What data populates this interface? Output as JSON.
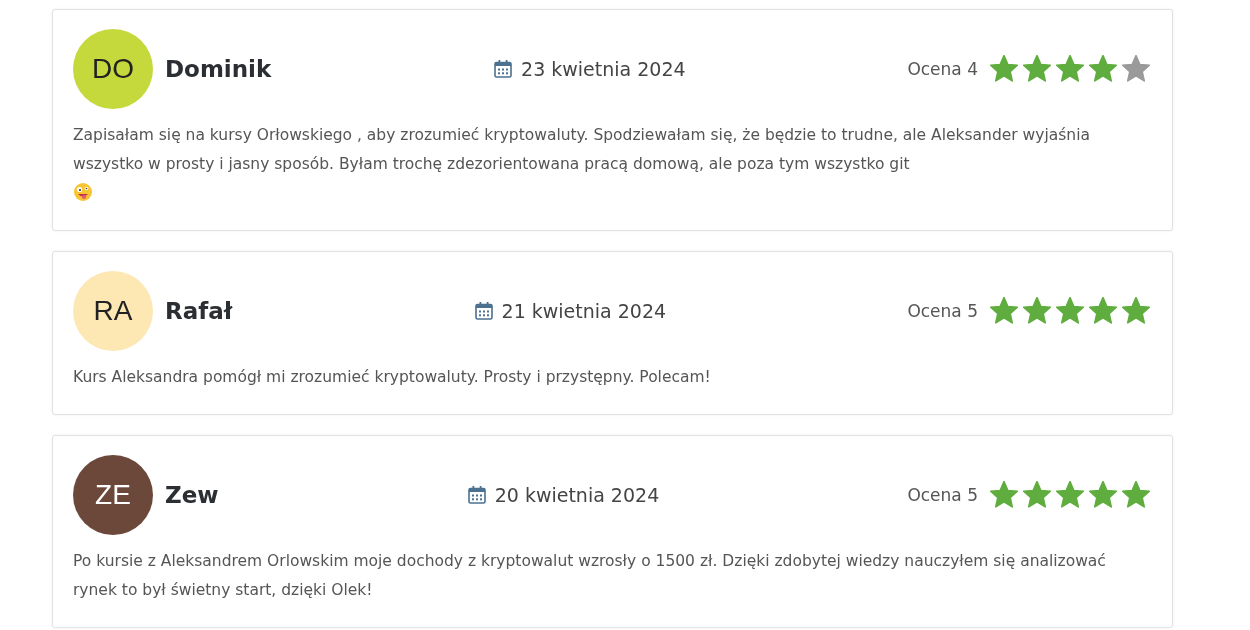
{
  "reviews": [
    {
      "initials": "DO",
      "color": "#c6d93c",
      "name": "Dominik",
      "date": "23 kwietnia 2024",
      "rating_label": "Ocena 4",
      "stars": 4,
      "text": "Zapisałam się na kursy Orłowskiego , aby zrozumieć kryptowaluty. Spodziewałam się, że będzie to trudne, ale Aleksander wyjaśnia wszystko w prosty i jasny sposób. Byłam trochę zdezorientowana pracą domową, ale poza tym wszystko git",
      "emoji": true
    },
    {
      "initials": "RA",
      "color": "#fde8b4",
      "name": "Rafał",
      "date": "21 kwietnia 2024",
      "rating_label": "Ocena 5",
      "stars": 5,
      "text": "Kurs Aleksandra pomógł mi zrozumieć kryptowaluty. Prosty i przystępny. Polecam!",
      "emoji": false
    },
    {
      "initials": "ZE",
      "color": "#6b4839",
      "name": "Zew",
      "date": "20 kwietnia 2024",
      "rating_label": "Ocena 5",
      "stars": 5,
      "text": "Po kursie z Aleksandrem Orlowskim moje dochody z kryptowalut wzrosły o 1500 zł. Dzięki zdobytej wiedzy nauczyłem się analizować rynek to był świetny start, dzięki Olek!",
      "emoji": false
    }
  ]
}
